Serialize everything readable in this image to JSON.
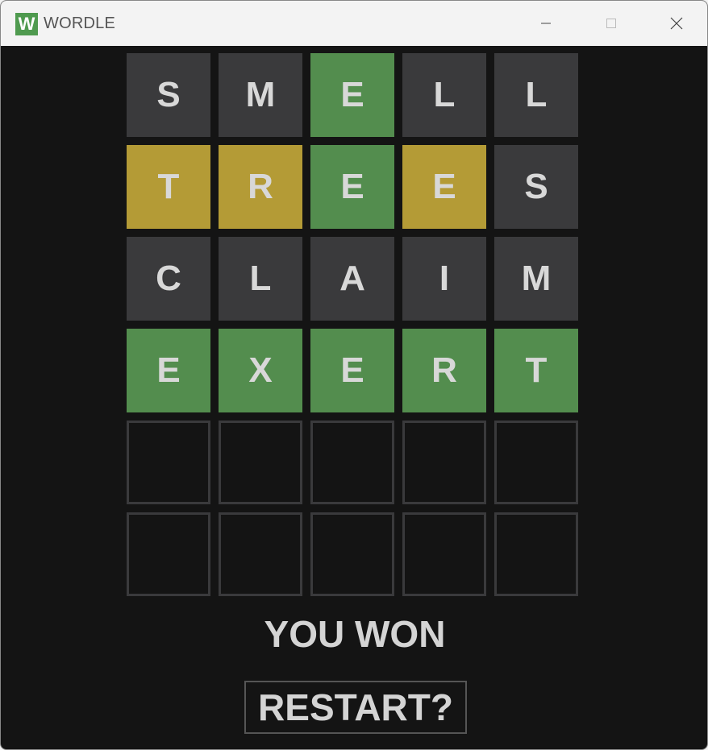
{
  "window": {
    "logo_letter": "W",
    "title": "WORDLE",
    "controls": [
      "minimize-icon",
      "maximize-icon",
      "close-icon"
    ]
  },
  "colors": {
    "correct": "#538d4e",
    "present": "#b49b36",
    "absent": "#3a3a3c",
    "background": "#141414",
    "logo": "#4f9a4f"
  },
  "board": {
    "rows": [
      {
        "letters": [
          "S",
          "M",
          "E",
          "L",
          "L"
        ],
        "states": [
          "absent",
          "absent",
          "correct",
          "absent",
          "absent"
        ]
      },
      {
        "letters": [
          "T",
          "R",
          "E",
          "E",
          "S"
        ],
        "states": [
          "present",
          "present",
          "correct",
          "present",
          "absent"
        ]
      },
      {
        "letters": [
          "C",
          "L",
          "A",
          "I",
          "M"
        ],
        "states": [
          "absent",
          "absent",
          "absent",
          "absent",
          "absent"
        ]
      },
      {
        "letters": [
          "E",
          "X",
          "E",
          "R",
          "T"
        ],
        "states": [
          "correct",
          "correct",
          "correct",
          "correct",
          "correct"
        ]
      },
      {
        "letters": [
          "",
          "",
          "",
          "",
          ""
        ],
        "states": [
          "empty",
          "empty",
          "empty",
          "empty",
          "empty"
        ]
      },
      {
        "letters": [
          "",
          "",
          "",
          "",
          ""
        ],
        "states": [
          "empty",
          "empty",
          "empty",
          "empty",
          "empty"
        ]
      }
    ]
  },
  "status": {
    "message": "YOU WON",
    "restart_label": "RESTART?"
  }
}
